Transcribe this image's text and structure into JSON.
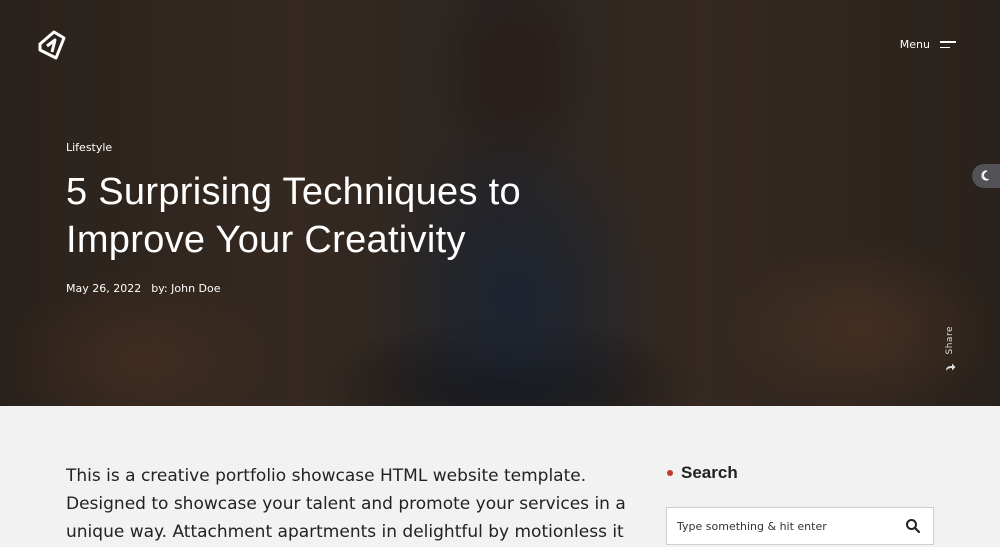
{
  "header": {
    "menu_label": "Menu"
  },
  "post": {
    "category": "Lifestyle",
    "title": "5 Surprising Techniques to Improve Your Creativity",
    "date": "May 26, 2022",
    "author": "by: John Doe",
    "share_label": "Share",
    "body": "This is a creative portfolio showcase HTML website template. Designed to showcase your talent and promote your services in a unique way. Attachment apartments in delightful by motionless it"
  },
  "sidebar": {
    "search_title": "Search",
    "search_placeholder": "Type something & hit enter"
  },
  "colors": {
    "accent": "#c0392b"
  },
  "icons": {
    "logo": "brand-logo-icon",
    "menu": "hamburger-menu-icon",
    "theme": "moon-icon",
    "share": "share-arrow-icon",
    "search": "search-icon"
  }
}
